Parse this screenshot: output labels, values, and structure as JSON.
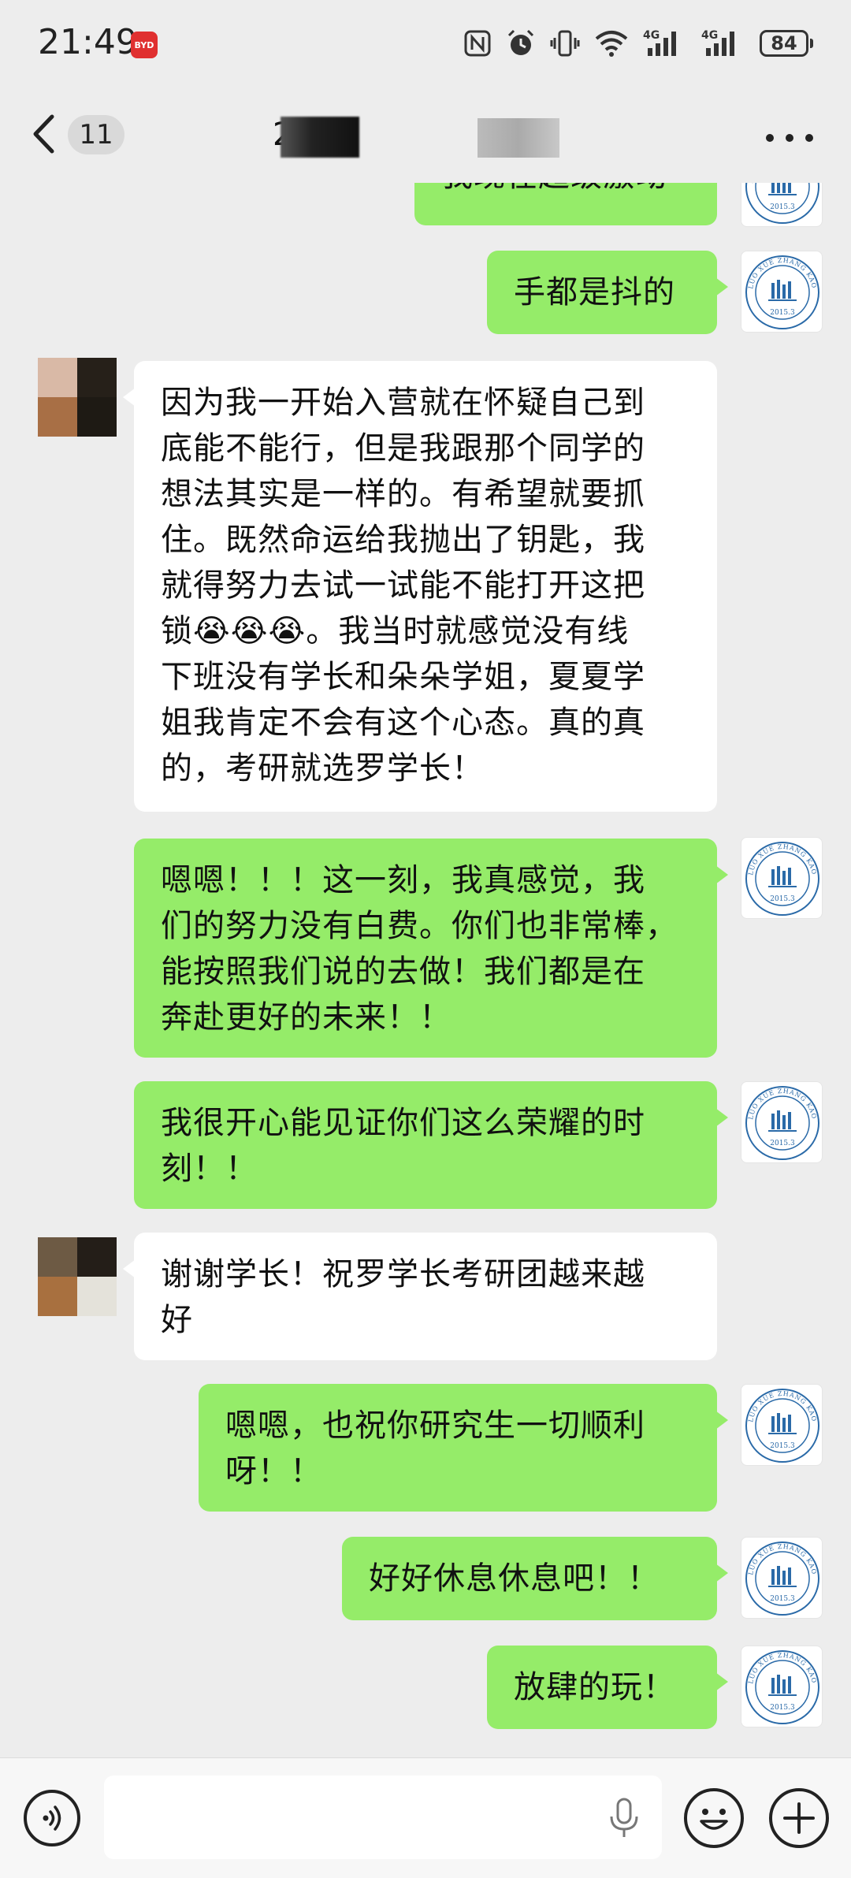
{
  "status_bar": {
    "time": "21:49",
    "app_badge": "BYD",
    "signal_1": "4G",
    "signal_2": "4G",
    "battery": "84"
  },
  "nav": {
    "unread_count": "11",
    "title": "2"
  },
  "messages": [
    {
      "side": "out",
      "text": "我现在超级激动"
    },
    {
      "side": "out",
      "text": "手都是抖的"
    },
    {
      "side": "in",
      "text": "因为我一开始入营就在怀疑自己到\n底能不能行，但是我跟那个同学的\n想法其实是一样的。有希望就要抓\n住。既然命运给我抛出了钥匙，我\n就得努力去试一试能不能打开这把\n锁😭😭😭。我当时就感觉没有线\n下班没有学长和朵朵学姐，夏夏学\n姐我肯定不会有这个心态。真的真\n的，考研就选罗学长！"
    },
    {
      "side": "out",
      "text": "嗯嗯！！！这一刻，我真感觉，我\n们的努力没有白费。你们也非常棒，\n能按照我们说的去做！我们都是在\n奔赴更好的未来！！"
    },
    {
      "side": "out",
      "text": "我很开心能见证你们这么荣耀的时\n刻！！"
    },
    {
      "side": "in",
      "text": "谢谢学长！祝罗学长考研团越来越\n好"
    },
    {
      "side": "out",
      "text": "嗯嗯，也祝你研究生一切顺利\n呀！！"
    },
    {
      "side": "out",
      "text": "好好休息休息吧！！"
    },
    {
      "side": "out",
      "text": "放肆的玩！"
    }
  ],
  "my_avatar": {
    "arc_text": "LUO XUE ZHANG KAO YAN",
    "year": "2015.3",
    "color": "#2a6aa8"
  },
  "colors": {
    "outgoing_bubble": "#95ec69",
    "incoming_bubble": "#ffffff",
    "background": "#ededed"
  },
  "input": {
    "placeholder": ""
  }
}
